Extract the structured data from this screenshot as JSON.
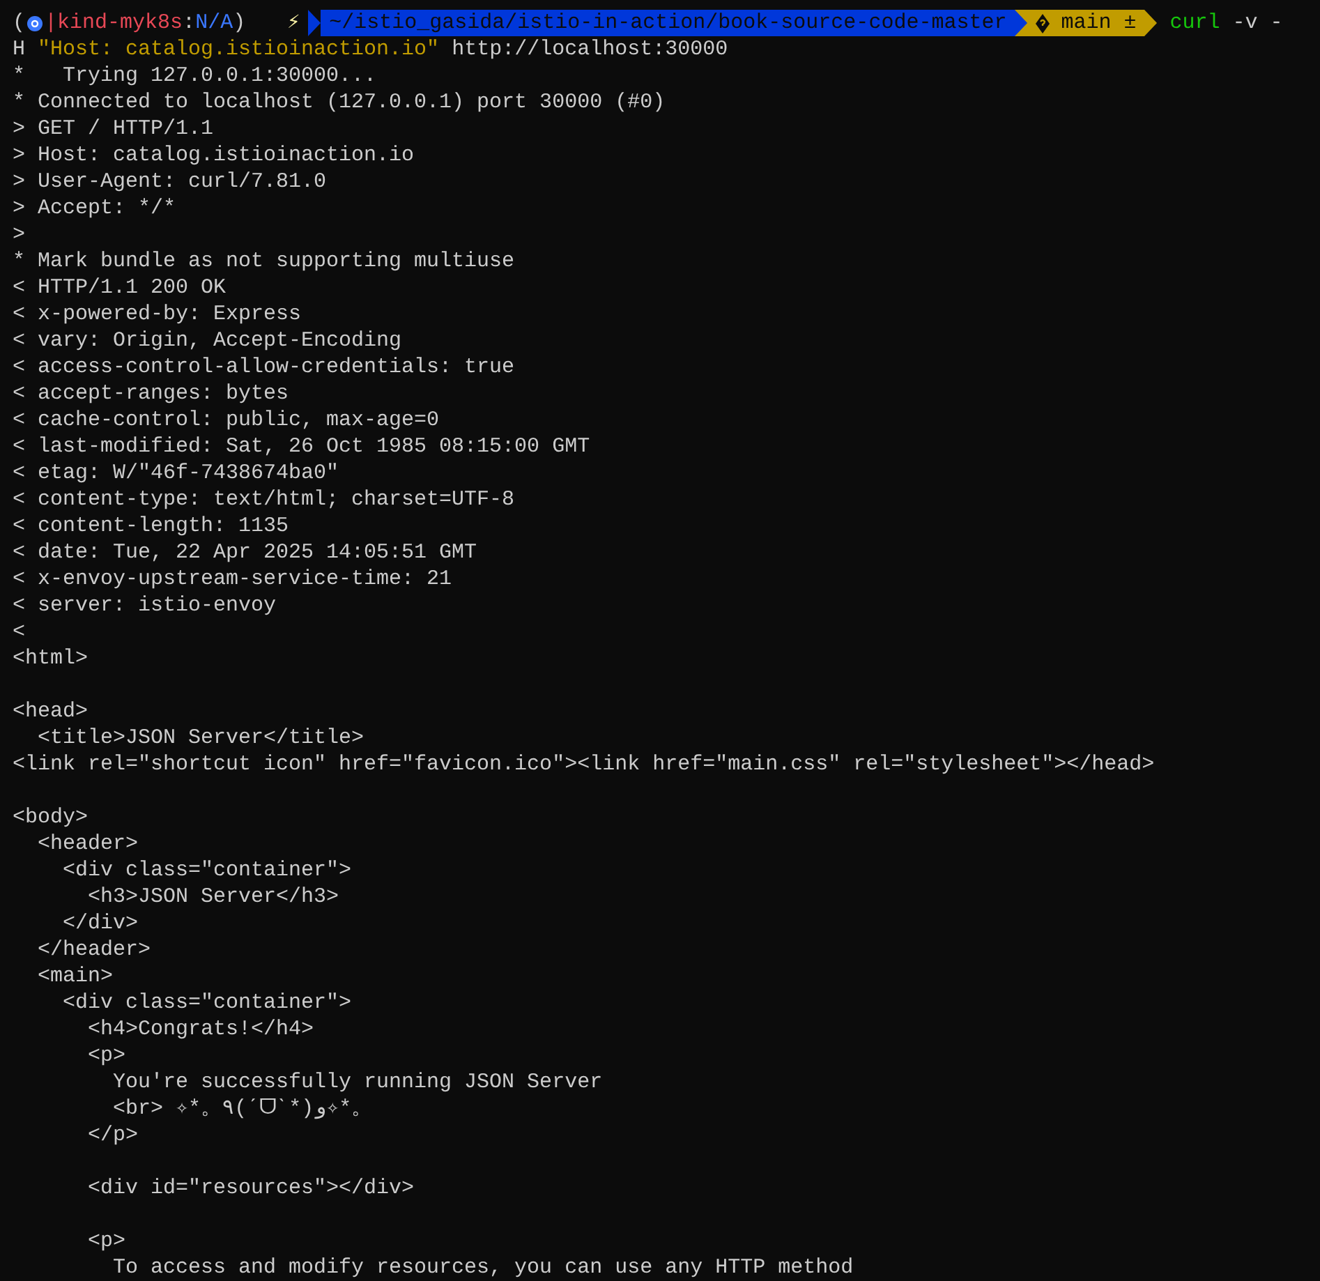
{
  "prompt": {
    "open_paren": "(",
    "separator": "|",
    "context": "kind-myk8s",
    "colon": ":",
    "namespace": "N/A",
    "close_paren": ")",
    "bolt": "⚡",
    "path": "~/istio_gasida/istio-in-action/book-source-code-master",
    "branch": "main ±",
    "command": "curl",
    "args": "-v -",
    "wrap_flag": "H",
    "header_arg": "\"Host: catalog.istioinaction.io\"",
    "url": "http://localhost:30000"
  },
  "output": [
    {
      "kind": "text",
      "text": "*   Trying 127.0.0.1:30000..."
    },
    {
      "kind": "text",
      "text": "* Connected to localhost (127.0.0.1) port 30000 (#0)"
    },
    {
      "kind": "text",
      "text": "> GET / HTTP/1.1"
    },
    {
      "kind": "text",
      "text": "> Host: catalog.istioinaction.io"
    },
    {
      "kind": "text",
      "text": "> User-Agent: curl/7.81.0"
    },
    {
      "kind": "text",
      "text": "> Accept: */*"
    },
    {
      "kind": "text",
      "text": ">"
    },
    {
      "kind": "text",
      "text": "* Mark bundle as not supporting multiuse"
    },
    {
      "kind": "text",
      "text": "< HTTP/1.1 200 OK"
    },
    {
      "kind": "text",
      "text": "< x-powered-by: Express"
    },
    {
      "kind": "text",
      "text": "< vary: Origin, Accept-Encoding"
    },
    {
      "kind": "text",
      "text": "< access-control-allow-credentials: true"
    },
    {
      "kind": "text",
      "text": "< accept-ranges: bytes"
    },
    {
      "kind": "text",
      "text": "< cache-control: public, max-age=0"
    },
    {
      "kind": "text",
      "text": "< last-modified: Sat, 26 Oct 1985 08:15:00 GMT"
    },
    {
      "kind": "text",
      "text": "< etag: W/\"46f-7438674ba0\""
    },
    {
      "kind": "text",
      "text": "< content-type: text/html; charset=UTF-8"
    },
    {
      "kind": "text",
      "text": "< content-length: 1135"
    },
    {
      "kind": "text",
      "text": "< date: Tue, 22 Apr 2025 14:05:51 GMT"
    },
    {
      "kind": "text",
      "text": "< x-envoy-upstream-service-time: 21"
    },
    {
      "kind": "text",
      "text": "< server: istio-envoy"
    },
    {
      "kind": "text",
      "text": "<"
    },
    {
      "kind": "text",
      "text": "<html>"
    },
    {
      "kind": "blank"
    },
    {
      "kind": "text",
      "text": "<head>"
    },
    {
      "kind": "text",
      "text": "  <title>JSON Server</title>"
    },
    {
      "kind": "text",
      "text": "<link rel=\"shortcut icon\" href=\"favicon.ico\"><link href=\"main.css\" rel=\"stylesheet\"></head>"
    },
    {
      "kind": "blank"
    },
    {
      "kind": "text",
      "text": "<body>"
    },
    {
      "kind": "text",
      "text": "  <header>"
    },
    {
      "kind": "text",
      "text": "    <div class=\"container\">"
    },
    {
      "kind": "text",
      "text": "      <h3>JSON Server</h3>"
    },
    {
      "kind": "text",
      "text": "    </div>"
    },
    {
      "kind": "text",
      "text": "  </header>"
    },
    {
      "kind": "text",
      "text": "  <main>"
    },
    {
      "kind": "text",
      "text": "    <div class=\"container\">"
    },
    {
      "kind": "text",
      "text": "      <h4>Congrats!</h4>"
    },
    {
      "kind": "text",
      "text": "      <p>"
    },
    {
      "kind": "text",
      "text": "        You're successfully running JSON Server"
    },
    {
      "kind": "text",
      "text": "        <br> ✧*。٩(ˊᗜˋ*)و✧*。"
    },
    {
      "kind": "text",
      "text": "      </p>"
    },
    {
      "kind": "blank"
    },
    {
      "kind": "text",
      "text": "      <div id=\"resources\"></div>"
    },
    {
      "kind": "blank"
    },
    {
      "kind": "text",
      "text": "      <p>"
    },
    {
      "kind": "text",
      "text": "        To access and modify resources, you can use any HTTP method"
    }
  ]
}
